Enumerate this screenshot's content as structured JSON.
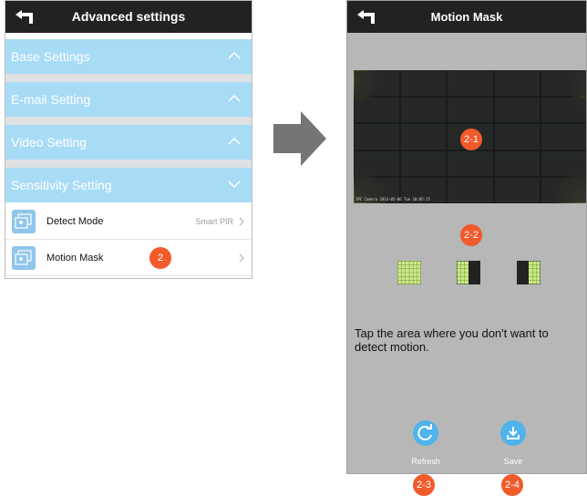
{
  "left_screen": {
    "title": "Advanced settings",
    "sections": [
      {
        "label": "Base Settings",
        "state": "collapsed"
      },
      {
        "label": "E-mail Setting",
        "state": "collapsed"
      },
      {
        "label": "Video Setting",
        "state": "collapsed"
      },
      {
        "label": "Sensitivity Setting",
        "state": "expanded"
      }
    ],
    "rows": [
      {
        "label": "Detect Mode",
        "value": "Smart PIR",
        "icon": "detect-mode-icon"
      },
      {
        "label": "Motion Mask",
        "value": "",
        "icon": "motion-mask-icon"
      }
    ]
  },
  "callouts": {
    "c2": "2",
    "c2_1": "2-1",
    "c2_2": "2-2",
    "c2_3": "2-3",
    "c2_4": "2-4"
  },
  "right_screen": {
    "title": "Motion Mask",
    "camera_timestamp": "IPC Camera  2014-05-06 Tue 10:05:15",
    "instruction": "Tap the area where you don't want to detect motion.",
    "mask_options": [
      "select-all-icon",
      "select-left-half-icon",
      "select-right-half-icon"
    ],
    "buttons": [
      {
        "label": "Refresh",
        "icon": "refresh-icon"
      },
      {
        "label": "Save",
        "icon": "save-icon"
      }
    ]
  },
  "colors": {
    "accent": "#4fb3ec",
    "section_bg": "#a8dcf6",
    "callout": "#f15a2b",
    "topbar": "#222222",
    "screen_bg": "#b7b7b7"
  }
}
